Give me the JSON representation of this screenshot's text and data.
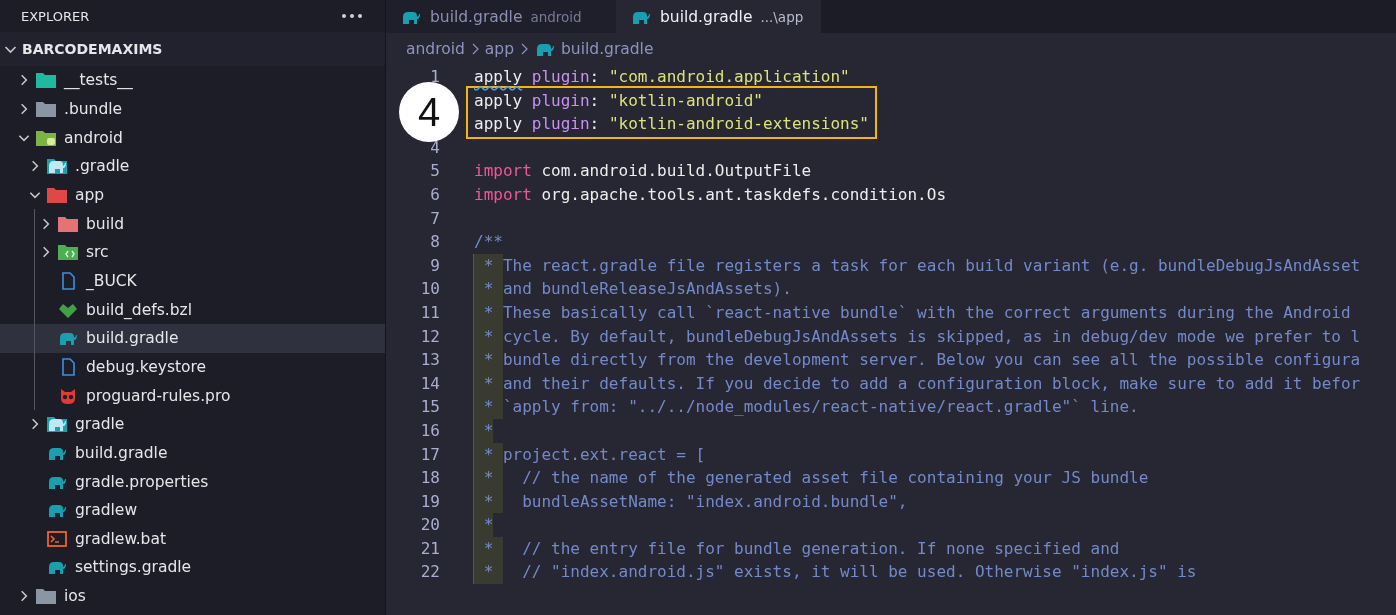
{
  "sidebar": {
    "title": "EXPLORER",
    "section": {
      "label": "BARCODEMAXIMS",
      "expanded": true
    },
    "tree": [
      {
        "name": "__tests__",
        "kind": "folder-tests",
        "expanded": false,
        "selected": false
      },
      {
        "name": ".bundle",
        "kind": "folder-plain",
        "expanded": false,
        "selected": false
      },
      {
        "name": "android",
        "kind": "folder-android",
        "expanded": true,
        "selected": false,
        "children": [
          {
            "name": ".gradle",
            "kind": "folder-gradle",
            "expanded": false,
            "selected": false
          },
          {
            "name": "app",
            "kind": "folder-app",
            "expanded": true,
            "selected": false,
            "children": [
              {
                "name": "build",
                "kind": "folder-build",
                "expanded": false,
                "selected": false
              },
              {
                "name": "src",
                "kind": "folder-src",
                "expanded": false,
                "selected": false
              },
              {
                "name": "_BUCK",
                "kind": "file",
                "selected": false
              },
              {
                "name": "build_defs.bzl",
                "kind": "bazel",
                "selected": false
              },
              {
                "name": "build.gradle",
                "kind": "gradle",
                "selected": true
              },
              {
                "name": "debug.keystore",
                "kind": "file",
                "selected": false
              },
              {
                "name": "proguard-rules.pro",
                "kind": "owl",
                "selected": false
              }
            ]
          },
          {
            "name": "gradle",
            "kind": "folder-gradle",
            "expanded": false,
            "selected": false
          },
          {
            "name": "build.gradle",
            "kind": "gradle",
            "selected": false
          },
          {
            "name": "gradle.properties",
            "kind": "gradle",
            "selected": false
          },
          {
            "name": "gradlew",
            "kind": "gradle",
            "selected": false
          },
          {
            "name": "gradlew.bat",
            "kind": "terminal",
            "selected": false
          },
          {
            "name": "settings.gradle",
            "kind": "gradle",
            "selected": false
          }
        ]
      },
      {
        "name": "ios",
        "kind": "folder-ios",
        "expanded": false,
        "selected": false
      }
    ]
  },
  "tabs": [
    {
      "name": "build.gradle",
      "description": "android",
      "selected": false
    },
    {
      "name": "build.gradle",
      "description": "...\\app",
      "selected": true
    }
  ],
  "breadcrumb": [
    "android",
    "app",
    "build.gradle"
  ],
  "callout": {
    "label": "4"
  },
  "code": [
    {
      "number": "1",
      "tokens": [
        {
          "text": "apply",
          "kind": "plain",
          "squiggle": true
        },
        {
          "text": " plugin",
          "kind": "keyword"
        },
        {
          "text": ": ",
          "kind": "plain"
        },
        {
          "text": "\"com.android.application\"",
          "kind": "string"
        }
      ]
    },
    {
      "highlight": true,
      "tokens": [
        {
          "text": "apply",
          "kind": "plain"
        },
        {
          "text": " plugin",
          "kind": "keyword"
        },
        {
          "text": ": ",
          "kind": "plain"
        },
        {
          "text": "\"kotlin-android\"",
          "kind": "string"
        }
      ]
    },
    {
      "highlight": true,
      "tokens": [
        {
          "text": "apply",
          "kind": "plain"
        },
        {
          "text": " plugin",
          "kind": "keyword"
        },
        {
          "text": ": ",
          "kind": "plain"
        },
        {
          "text": "\"kotlin-android-extensions\"",
          "kind": "string"
        }
      ]
    },
    {
      "number": "4"
    },
    {
      "number": "5",
      "tokens": [
        {
          "text": "import",
          "kind": "import"
        },
        {
          "text": " com.android.build.OutputFile",
          "kind": "plain"
        }
      ]
    },
    {
      "number": "6",
      "tokens": [
        {
          "text": "import",
          "kind": "import"
        },
        {
          "text": " org.apache.tools.ant.taskdefs.condition.Os",
          "kind": "plain"
        }
      ]
    },
    {
      "number": "7"
    },
    {
      "number": "8",
      "tokens": [
        {
          "text": "/**",
          "kind": "comment"
        }
      ]
    },
    {
      "number": "9",
      "kind": "doc",
      "tokens": [
        {
          "text": " * The react.gradle file registers a task for each build variant (e.g. bundleDebugJsAndAsset",
          "kind": "comment"
        }
      ]
    },
    {
      "number": "10",
      "kind": "doc",
      "tokens": [
        {
          "text": " * and bundleReleaseJsAndAssets).",
          "kind": "comment"
        }
      ]
    },
    {
      "number": "11",
      "kind": "doc",
      "tokens": [
        {
          "text": " * These basically call `react-native bundle` with the correct arguments during the Android",
          "kind": "comment"
        }
      ]
    },
    {
      "number": "12",
      "kind": "doc",
      "tokens": [
        {
          "text": " * cycle. By default, bundleDebugJsAndAssets is skipped, as in debug/dev mode we prefer to l",
          "kind": "comment"
        }
      ]
    },
    {
      "number": "13",
      "kind": "doc",
      "tokens": [
        {
          "text": " * bundle directly from the development server. Below you can see all the possible configura",
          "kind": "comment"
        }
      ]
    },
    {
      "number": "14",
      "kind": "doc",
      "tokens": [
        {
          "text": " * and their defaults. If you decide to add a configuration block, make sure to add it befor",
          "kind": "comment"
        }
      ]
    },
    {
      "number": "15",
      "kind": "doc",
      "tokens": [
        {
          "text": " * `apply from: \"../../node_modules/react-native/react.gradle\"` line.",
          "kind": "comment"
        }
      ]
    },
    {
      "number": "16",
      "kind": "doc",
      "tokens": [
        {
          "text": " *",
          "kind": "comment"
        }
      ]
    },
    {
      "number": "17",
      "kind": "doc",
      "tokens": [
        {
          "text": " * project.ext.react = [",
          "kind": "comment"
        }
      ]
    },
    {
      "number": "18",
      "kind": "doc",
      "tokens": [
        {
          "text": " *   // the name of the generated asset file containing your JS bundle",
          "kind": "comment"
        }
      ]
    },
    {
      "number": "19",
      "kind": "doc",
      "tokens": [
        {
          "text": " *   bundleAssetName: \"index.android.bundle\",",
          "kind": "comment"
        }
      ]
    },
    {
      "number": "20",
      "kind": "doc",
      "tokens": [
        {
          "text": " *",
          "kind": "comment"
        }
      ]
    },
    {
      "number": "21",
      "kind": "doc",
      "tokens": [
        {
          "text": " *   // the entry file for bundle generation. If none specified and",
          "kind": "comment"
        }
      ]
    },
    {
      "number": "22",
      "kind": "doc",
      "tokens": [
        {
          "text": " *   // \"index.android.js\" exists, it will be used. Otherwise \"index.js\" is",
          "kind": "comment"
        }
      ]
    }
  ]
}
